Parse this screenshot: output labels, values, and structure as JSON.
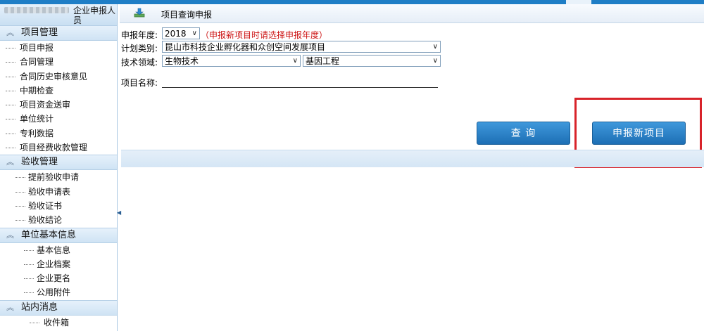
{
  "sidebar": {
    "user_label": "企业申报人员",
    "groups": [
      {
        "label": "项目管理",
        "items": [
          "项目申报",
          "合同管理",
          "合同历史审核意见",
          "中期检查",
          "项目资金送审",
          "单位统计",
          "专利数据",
          "项目经费收款管理"
        ]
      },
      {
        "label": "验收管理",
        "items": [
          "提前验收申请",
          "验收申请表",
          "验收证书",
          "验收结论"
        ]
      },
      {
        "label": "单位基本信息",
        "items": [
          "基本信息",
          "企业档案",
          "企业更名",
          "公用附件"
        ]
      },
      {
        "label": "站内消息",
        "items": [
          "收件箱"
        ]
      }
    ]
  },
  "header": {
    "title": "项目查询申报",
    "icon": "download-icon"
  },
  "form": {
    "year_label": "申报年度:",
    "year_value": "2018",
    "year_hint": "（申报新项目时请选择申报年度）",
    "plan_label": "计划类别:",
    "plan_value": "昆山市科技企业孵化器和众创空间发展项目",
    "field_label": "技术领域:",
    "field_value": "生物技术",
    "subfield_value": "基因工程",
    "name_label": "项目名称:",
    "name_value": ""
  },
  "buttons": {
    "query": "查 询",
    "new_project": "申报新项目"
  },
  "colors": {
    "accent": "#1f7ec6",
    "highlight": "#d8232a",
    "hint": "#cc1111"
  }
}
